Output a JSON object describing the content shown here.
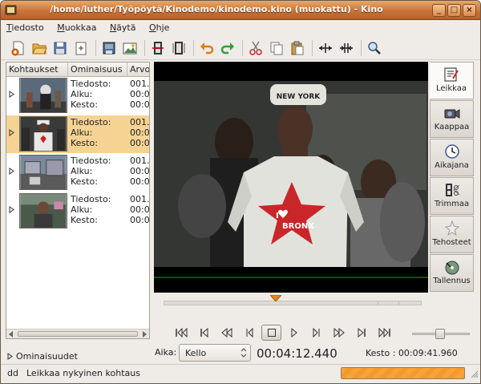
{
  "window": {
    "title": "/home/luther/Työpöytä/Kinodemo/kinodemo.kino (muokattu) - Kino",
    "controls": [
      "_",
      "□",
      "×"
    ]
  },
  "menu": {
    "items": [
      "Tiedosto",
      "Muokkaa",
      "Näytä",
      "Ohje"
    ]
  },
  "toolbar": {
    "icons": [
      "new-icon",
      "open-icon",
      "save-icon",
      "export-icon",
      "save-frame-icon",
      "publish-icon",
      "split-scene-icon",
      "join-scene-icon",
      "undo-icon",
      "redo-icon",
      "cut-icon",
      "copy-icon",
      "paste-icon",
      "expand-icon",
      "contract-icon",
      "zoom-icon"
    ]
  },
  "storyboard": {
    "columns": [
      "Kohtaukset",
      "Ominaisuus",
      "Arvo"
    ],
    "field_labels": [
      "Tiedosto:",
      "Alku:",
      "Kesto:"
    ],
    "scenes": [
      {
        "values": [
          "001.",
          "00:0",
          "00:0"
        ],
        "selected": false
      },
      {
        "values": [
          "001.",
          "00:0",
          "00:0"
        ],
        "selected": true
      },
      {
        "values": [
          "001.",
          "00:0",
          "00:0"
        ],
        "selected": false
      },
      {
        "values": [
          "001.",
          "00:0",
          "00:0"
        ],
        "selected": false
      }
    ]
  },
  "properties_expander": "Ominaisuudet",
  "side_tabs": [
    {
      "label": "Leikkaa",
      "icon": "edit-icon",
      "active": true
    },
    {
      "label": "Kaappaa",
      "icon": "capture-icon",
      "active": false
    },
    {
      "label": "Aikajana",
      "icon": "clock-icon",
      "active": false
    },
    {
      "label": "Trimmaa",
      "icon": "trim-icon",
      "active": false
    },
    {
      "label": "Tehosteet",
      "icon": "effects-icon",
      "active": false
    },
    {
      "label": "Tallennus",
      "icon": "export-icon",
      "active": false
    }
  ],
  "video": {
    "shirt_text_top": "I",
    "shirt_text_bottom": "BRONX",
    "cap_text": "NEW YORK"
  },
  "playback": {
    "aika_label": "Aika:",
    "time_format": "Kello",
    "current_time": "00:04:12.440",
    "duration": "Kesto : 00:09:41.960",
    "seek_fraction": 0.434,
    "volume_fraction": 0.48
  },
  "status": {
    "mode": "dd",
    "message": "Leikkaa nykyinen kohtaus",
    "progress_fraction": 1.0
  }
}
